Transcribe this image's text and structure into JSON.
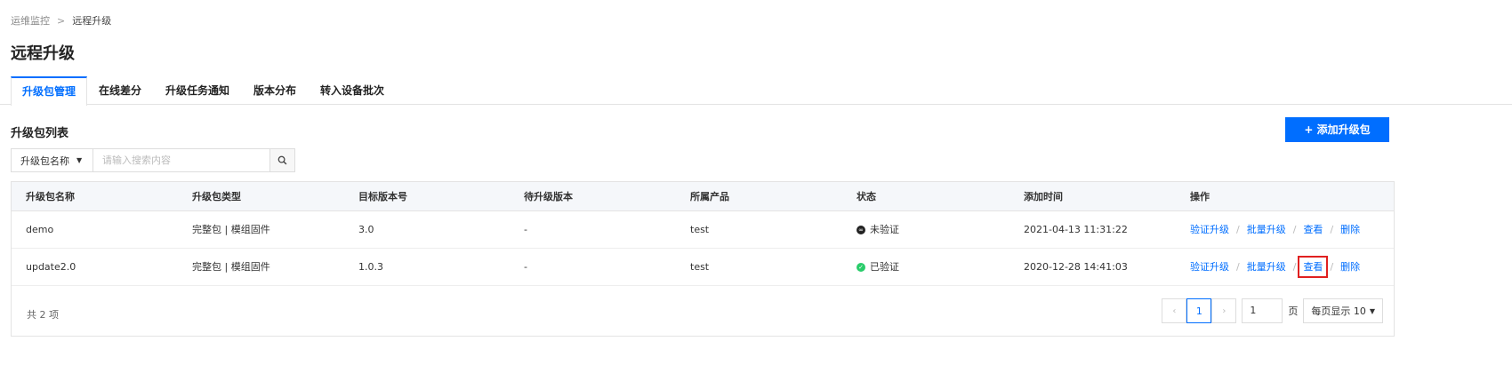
{
  "breadcrumb": {
    "parent": "运维监控",
    "separator": ">",
    "current": "远程升级"
  },
  "page_title": "远程升级",
  "tabs": [
    {
      "label": "升级包管理",
      "active": true
    },
    {
      "label": "在线差分",
      "active": false
    },
    {
      "label": "升级任务通知",
      "active": false
    },
    {
      "label": "版本分布",
      "active": false
    },
    {
      "label": "转入设备批次",
      "active": false
    }
  ],
  "section_title": "升级包列表",
  "add_button": "+ 添加升级包",
  "search": {
    "field": "升级包名称",
    "placeholder": "请输入搜索内容"
  },
  "table": {
    "columns": [
      "升级包名称",
      "升级包类型",
      "目标版本号",
      "待升级版本",
      "所属产品",
      "状态",
      "添加时间",
      "操作"
    ],
    "rows": [
      {
        "name": "demo",
        "type": "完整包 | 模组固件",
        "target_version": "3.0",
        "pending_version": "-",
        "product": "test",
        "status": "未验证",
        "status_color": "#222222",
        "added": "2021-04-13 11:31:22"
      },
      {
        "name": "update2.0",
        "type": "完整包 | 模组固件",
        "target_version": "1.0.3",
        "pending_version": "-",
        "product": "test",
        "status": "已验证",
        "status_color": "#29cc6a",
        "added": "2020-12-28 14:41:03"
      }
    ],
    "actions": [
      "验证升级",
      "批量升级",
      "查看",
      "删除"
    ]
  },
  "pagination": {
    "total": "共 2 项",
    "current_page": "1",
    "page_input": "1",
    "page_unit": "页",
    "page_size": "每页显示 10"
  },
  "colors": {
    "accent": "#006eff",
    "highlight": "#e02020"
  }
}
